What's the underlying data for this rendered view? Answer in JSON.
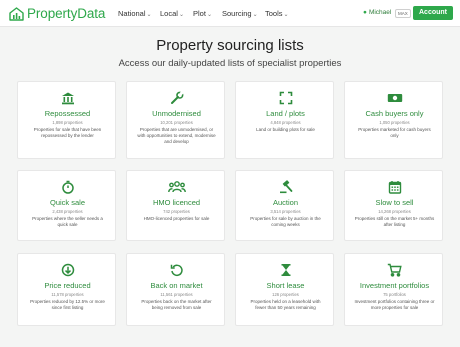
{
  "brand": {
    "name": "PropertyData",
    "accent": "#2ea84b",
    "title_green": "#2e8c3d"
  },
  "nav": {
    "items": [
      {
        "label": "National"
      },
      {
        "label": "Local"
      },
      {
        "label": "Plot"
      },
      {
        "label": "Sourcing"
      },
      {
        "label": "Tools"
      }
    ],
    "user_name": "Michael",
    "plan_badge": "MAX",
    "account_label": "Account"
  },
  "main": {
    "title": "Property sourcing lists",
    "subtitle": "Access our daily-updated lists of specialist properties"
  },
  "cards": [
    {
      "icon": "bank-icon",
      "title": "Repossessed",
      "count": "1,898 properties",
      "description": "Properties for sale that have been repossessed by the lender"
    },
    {
      "icon": "wrench-icon",
      "title": "Unmodernised",
      "count": "10,201 properties",
      "description": "Properties that are unmodernised, or with opportunities to extend, modernise and develop"
    },
    {
      "icon": "expand-icon",
      "title": "Land / plots",
      "count": "4,848 properties",
      "description": "Land or building plots for sale"
    },
    {
      "icon": "banknote-icon",
      "title": "Cash buyers only",
      "count": "1,050 properties",
      "description": "Properties marketed for cash buyers only"
    },
    {
      "icon": "stopwatch-icon",
      "title": "Quick sale",
      "count": "2,438 properties",
      "description": "Properties where the seller needs a quick sale"
    },
    {
      "icon": "people-icon",
      "title": "HMO licenced",
      "count": "742 properties",
      "description": "HMO-licenced properties for sale"
    },
    {
      "icon": "gavel-icon",
      "title": "Auction",
      "count": "3,514 properties",
      "description": "Properties for sale by auction in the coming weeks"
    },
    {
      "icon": "calendar-icon",
      "title": "Slow to sell",
      "count": "14,268 properties",
      "description": "Properties still on the market 5+ months after listing"
    },
    {
      "icon": "arrow-down-circle-icon",
      "title": "Price reduced",
      "count": "11,578 properties",
      "description": "Properties reduced by 12.5% or more since first listing"
    },
    {
      "icon": "undo-icon",
      "title": "Back on market",
      "count": "11,561 properties",
      "description": "Properties back on the market after being removed from sale"
    },
    {
      "icon": "hourglass-icon",
      "title": "Short lease",
      "count": "126 properties",
      "description": "Properties held on a leasehold with fewer than 50 years remaining"
    },
    {
      "icon": "cart-icon",
      "title": "Investment portfolios",
      "count": "75 portfolios",
      "description": "Investment portfolios containing three or more properties for sale"
    }
  ]
}
